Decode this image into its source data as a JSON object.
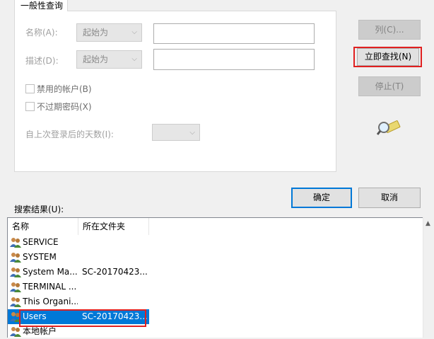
{
  "tab": {
    "label": "一般性查询"
  },
  "form": {
    "name_label": "名称(A):",
    "name_mode": "起始为",
    "desc_label": "描述(D):",
    "desc_mode": "起始为",
    "disabled_accounts": "禁用的帐户(B)",
    "non_expiring_pw": "不过期密码(X)",
    "days_label": "自上次登录后的天数(I):"
  },
  "buttons": {
    "columns": "列(C)...",
    "find_now": "立即查找(N)",
    "stop": "停止(T)",
    "ok": "确定",
    "cancel": "取消"
  },
  "results": {
    "label": "搜索结果(U):",
    "col_name": "名称",
    "col_folder": "所在文件夹",
    "rows": [
      {
        "name": "SERVICE",
        "folder": ""
      },
      {
        "name": "SYSTEM",
        "folder": ""
      },
      {
        "name": "System Ma...",
        "folder": "SC-20170423..."
      },
      {
        "name": "TERMINAL ...",
        "folder": ""
      },
      {
        "name": "This Organi...",
        "folder": ""
      },
      {
        "name": "Users",
        "folder": "SC-20170423...",
        "selected": true
      },
      {
        "name": "本地帐户",
        "folder": ""
      }
    ]
  },
  "colors": {
    "accent": "#0078d7",
    "highlight": "#e02020"
  }
}
